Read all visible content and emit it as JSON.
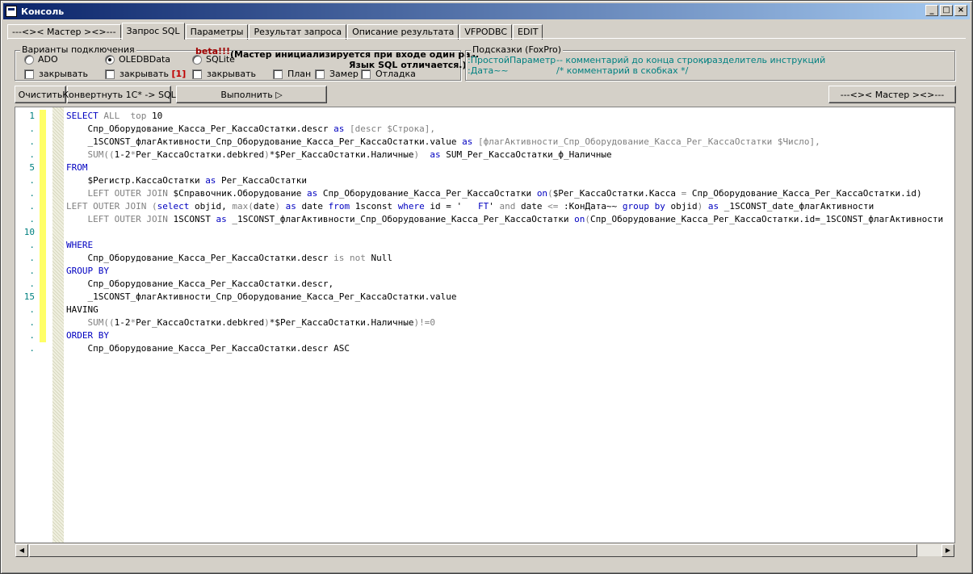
{
  "window": {
    "title": "Консоль",
    "min": "_",
    "max": "□",
    "close": "×"
  },
  "tabs": [
    {
      "label": "---<>< Мастер ><>---",
      "active": false
    },
    {
      "label": "Запрос SQL",
      "active": true
    },
    {
      "label": "Параметры",
      "active": false
    },
    {
      "label": "Результат запроса",
      "active": false
    },
    {
      "label": "Описание результата",
      "active": false
    },
    {
      "label": "VFPODBC",
      "active": false
    },
    {
      "label": "EDIT",
      "active": false
    }
  ],
  "connection": {
    "group_label": "Варианты подключения",
    "ado": "ADO",
    "oledb": "OLEDBData",
    "sqlite": "SQLite",
    "beta": "beta!!!",
    "note1": "(Мастер инициализируется при входе один раз.",
    "note2": "Язык SQL отличается.)",
    "close1": "закрывать",
    "close2": "закрывать",
    "close2_suffix": "[1]",
    "close3": "закрывать",
    "plan": "План",
    "zamer": "Замер",
    "debug": "Отладка"
  },
  "hints": {
    "group_label": "Подсказки (FoxPro)",
    "h1": ":ПростойПараметр",
    "h2": "-- комментарий до конца строки",
    "h3": ";  разделитель инструкций",
    "h4": ":Дата~~",
    "h5": "/* комментарий в скобках */"
  },
  "buttons": {
    "clear": "Очистить",
    "convert": "Конвертнуть 1С* -> SQL",
    "run": "Выполнить ▷",
    "master": "---<>< Мастер ><>---"
  },
  "gutter_numbers": [
    "1",
    ".",
    ".",
    ".",
    "5",
    ".",
    ".",
    ".",
    ".",
    "10",
    ".",
    ".",
    ".",
    ".",
    "15",
    ".",
    ".",
    ".",
    "."
  ],
  "code_lines": [
    [
      [
        "kw",
        "SELECT"
      ],
      [
        "t",
        " "
      ],
      [
        "gr",
        "ALL"
      ],
      [
        "t",
        "  "
      ],
      [
        "gr",
        "top"
      ],
      [
        "t",
        " 10"
      ]
    ],
    [
      [
        "t",
        "    Спр_Оборудование_Касса_Рег_КассаОстатки.descr "
      ],
      [
        "kw",
        "as"
      ],
      [
        "t",
        " "
      ],
      [
        "gr",
        "[descr $Строка],"
      ]
    ],
    [
      [
        "t",
        "    _1SCONST_флагАктивности_Спр_Оборудование_Касса_Рег_КассаОстатки.value "
      ],
      [
        "kw",
        "as"
      ],
      [
        "t",
        " "
      ],
      [
        "gr",
        "[флагАктивности_Спр_Оборудование_Касса_Рег_КассаОстатки $Число],"
      ]
    ],
    [
      [
        "t",
        "    "
      ],
      [
        "gr",
        "SUM(("
      ],
      [
        "t",
        "1-2"
      ],
      [
        "gr",
        "*"
      ],
      [
        "t",
        "Рег_КассаОстатки.debkred"
      ],
      [
        "gr",
        ")"
      ],
      [
        "t",
        "*$Рег_КассаОстатки.Наличные"
      ],
      [
        "gr",
        ")"
      ],
      [
        "t",
        "  "
      ],
      [
        "kw",
        "as"
      ],
      [
        "t",
        " SUM_Рег_КассаОстатки_ф_Наличные"
      ]
    ],
    [
      [
        "kw",
        "FROM"
      ]
    ],
    [
      [
        "t",
        "    $Регистр.КассаОстатки "
      ],
      [
        "kw",
        "as"
      ],
      [
        "t",
        " Рег_КассаОстатки"
      ]
    ],
    [
      [
        "t",
        "    "
      ],
      [
        "gr",
        "LEFT OUTER JOIN"
      ],
      [
        "t",
        " $Справочник.Оборудование "
      ],
      [
        "kw",
        "as"
      ],
      [
        "t",
        " Спр_Оборудование_Касса_Рег_КассаОстатки "
      ],
      [
        "kw",
        "on"
      ],
      [
        "gr",
        "("
      ],
      [
        "t",
        "$Рег_КассаОстатки.Касса "
      ],
      [
        "gr",
        "="
      ],
      [
        "t",
        " Спр_Оборудование_Касса_Рег_КассаОстатки.id)"
      ]
    ],
    [
      [
        "gr",
        "LEFT OUTER JOIN"
      ],
      [
        "t",
        " "
      ],
      [
        "gr",
        "("
      ],
      [
        "kw",
        "select"
      ],
      [
        "t",
        " objid, "
      ],
      [
        "gr",
        "max("
      ],
      [
        "t",
        "date"
      ],
      [
        "gr",
        ")"
      ],
      [
        "t",
        " "
      ],
      [
        "kw",
        "as"
      ],
      [
        "t",
        " date "
      ],
      [
        "kw",
        "from"
      ],
      [
        "t",
        " 1sconst "
      ],
      [
        "kw",
        "where"
      ],
      [
        "t",
        " id = '   "
      ],
      [
        "kw",
        "FT"
      ],
      [
        "t",
        "' "
      ],
      [
        "gr",
        "and"
      ],
      [
        "t",
        " date "
      ],
      [
        "gr",
        "<="
      ],
      [
        "t",
        " :КонДата~~ "
      ],
      [
        "kw",
        "group by"
      ],
      [
        "t",
        " objid"
      ],
      [
        "gr",
        ")"
      ],
      [
        "t",
        " "
      ],
      [
        "kw",
        "as"
      ],
      [
        "t",
        " _1SCONST_date_флагАктивности"
      ]
    ],
    [
      [
        "t",
        "    "
      ],
      [
        "gr",
        "LEFT OUTER JOIN"
      ],
      [
        "t",
        " 1SCONST "
      ],
      [
        "kw",
        "as"
      ],
      [
        "t",
        " _1SCONST_флагАктивности_Спр_Оборудование_Касса_Рег_КассаОстатки "
      ],
      [
        "kw",
        "on"
      ],
      [
        "gr",
        "("
      ],
      [
        "t",
        "Спр_Оборудование_Касса_Рег_КассаОстатки.id=_1SCONST_флагАктивности"
      ]
    ],
    [],
    [
      [
        "kw",
        "WHERE"
      ]
    ],
    [
      [
        "t",
        "    Спр_Оборудование_Касса_Рег_КассаОстатки.descr "
      ],
      [
        "gr",
        "is not"
      ],
      [
        "t",
        " Null"
      ]
    ],
    [
      [
        "kw",
        "GROUP BY"
      ]
    ],
    [
      [
        "t",
        "    Спр_Оборудование_Касса_Рег_КассаОстатки.descr,"
      ]
    ],
    [
      [
        "t",
        "    _1SCONST_флагАктивности_Спр_Оборудование_Касса_Рег_КассаОстатки.value"
      ]
    ],
    [
      [
        "t",
        "HAVING"
      ]
    ],
    [
      [
        "t",
        "    "
      ],
      [
        "gr",
        "SUM(("
      ],
      [
        "t",
        "1-2"
      ],
      [
        "gr",
        "*"
      ],
      [
        "t",
        "Рег_КассаОстатки.debkred"
      ],
      [
        "gr",
        ")"
      ],
      [
        "t",
        "*$Рег_КассаОстатки.Наличные"
      ],
      [
        "gr",
        ")!=0"
      ]
    ],
    [
      [
        "kw",
        "ORDER BY"
      ]
    ],
    [
      [
        "t",
        "    Спр_Оборудование_Касса_Рег_КассаОстатки.descr ASC"
      ]
    ]
  ],
  "scroll": {
    "left": "◀",
    "right": "▶"
  }
}
